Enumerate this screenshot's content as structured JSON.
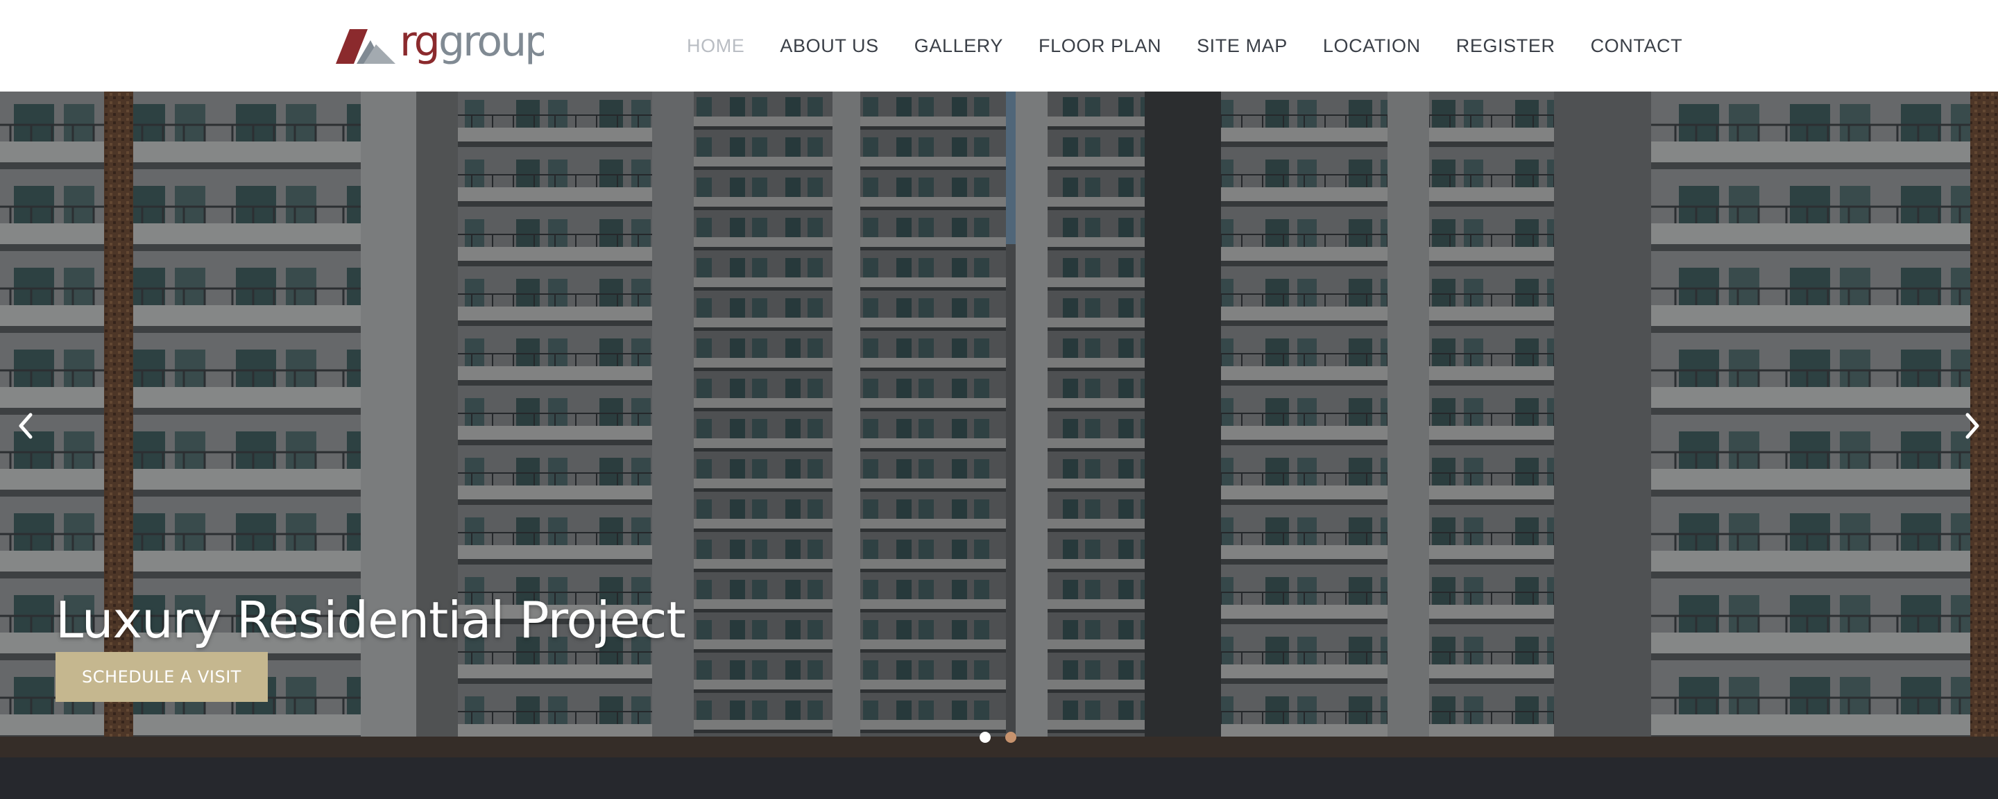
{
  "brand": {
    "logo_text": "rg group"
  },
  "nav": {
    "items": [
      {
        "label": "HOME",
        "active": true
      },
      {
        "label": "ABOUT US"
      },
      {
        "label": "GALLERY"
      },
      {
        "label": "FLOOR PLAN"
      },
      {
        "label": "SITE MAP"
      },
      {
        "label": "LOCATION"
      },
      {
        "label": "REGISTER"
      },
      {
        "label": "CONTACT"
      }
    ]
  },
  "hero": {
    "title": "Luxury Residential Project",
    "cta_label": "SCHEDULE A VISIT",
    "slide_count": 2,
    "active_slide": 1,
    "prev_icon": "chevron-left-icon",
    "next_icon": "chevron-right-icon"
  },
  "colors": {
    "cta_bg": "#c5b78f",
    "active_nav": "#b9bdc3",
    "nav_text": "#3a3f47",
    "dot_active": "#ffffff",
    "dot_inactive": "#c7936e",
    "footer_bg": "#26282d",
    "logo_red": "#8b2a2d",
    "logo_gray": "#808a93"
  }
}
